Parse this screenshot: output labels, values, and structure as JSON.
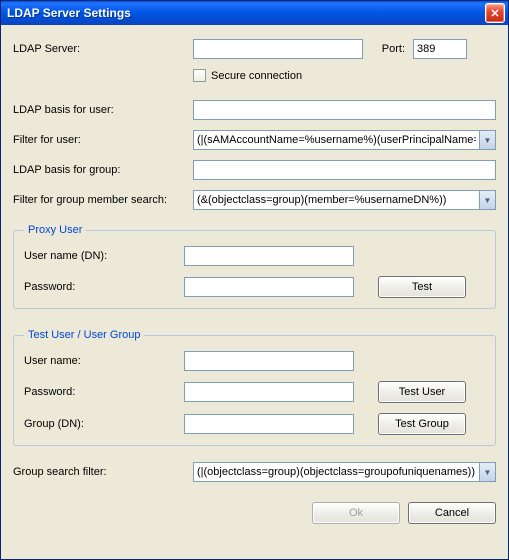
{
  "titlebar": {
    "title": "LDAP Server Settings"
  },
  "form": {
    "ldap_server_label": "LDAP Server:",
    "ldap_server_value": "",
    "port_label": "Port:",
    "port_value": "389",
    "secure_connection_label": "Secure connection",
    "secure_connection_checked": false,
    "ldap_basis_user_label": "LDAP basis for user:",
    "ldap_basis_user_value": "",
    "filter_user_label": "Filter for user:",
    "filter_user_value": "(|(sAMAccountName=%username%)(userPrincipalName=%",
    "ldap_basis_group_label": "LDAP basis for group:",
    "ldap_basis_group_value": "",
    "filter_group_member_label": "Filter for group member search:",
    "filter_group_member_value": "(&(objectclass=group)(member=%usernameDN%))",
    "group_search_filter_label": "Group search filter:",
    "group_search_filter_value": "(|(objectclass=group)(objectclass=groupofuniquenames))"
  },
  "proxy": {
    "legend": "Proxy User",
    "username_label": "User name (DN):",
    "username_value": "",
    "password_label": "Password:",
    "password_value": "",
    "test_button": "Test"
  },
  "testuser": {
    "legend": "Test User / User Group",
    "username_label": "User name:",
    "username_value": "",
    "password_label": "Password:",
    "password_value": "",
    "group_label": "Group (DN):",
    "group_value": "",
    "test_user_button": "Test User",
    "test_group_button": "Test Group"
  },
  "buttons": {
    "ok": "Ok",
    "cancel": "Cancel"
  }
}
